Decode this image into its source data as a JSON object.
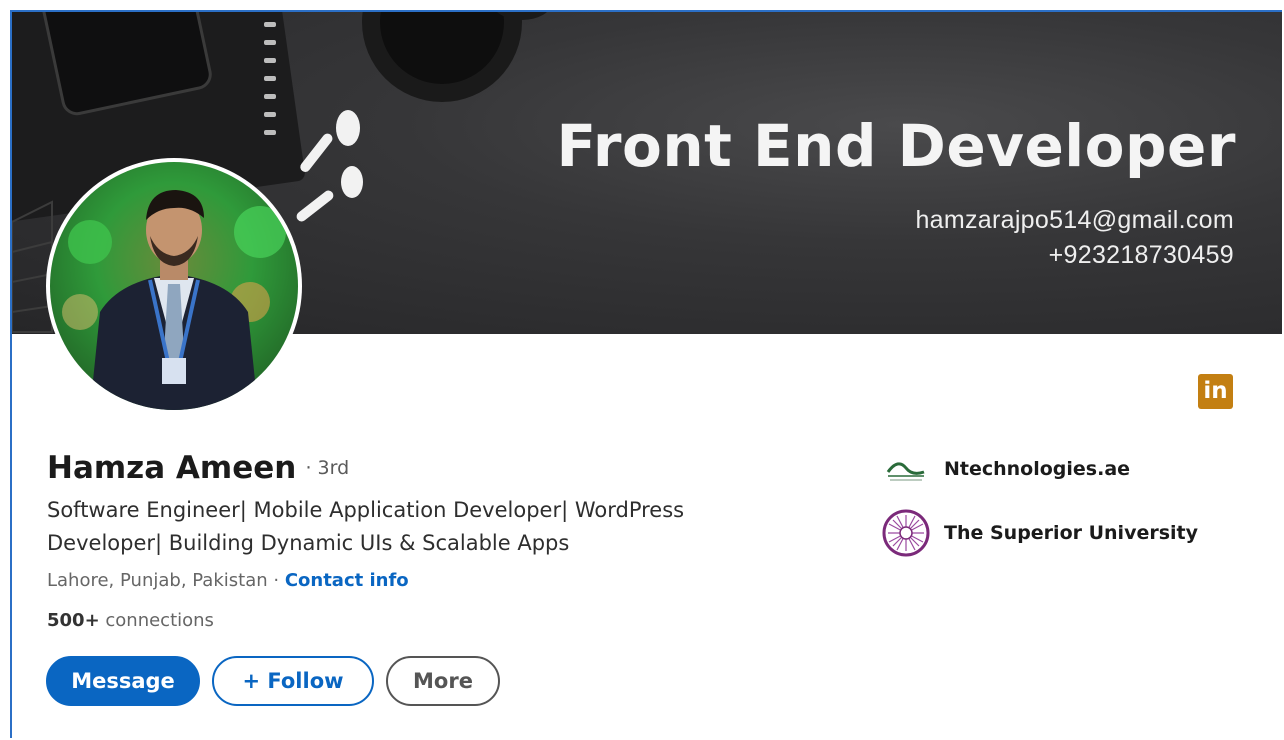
{
  "banner": {
    "title": "Front End Developer",
    "email": "hamzarajpo514@gmail.com",
    "phone": "+923218730459"
  },
  "profile": {
    "name": "Hamza Ameen",
    "degree": "· 3rd",
    "headline": "Software Engineer| Mobile Application Developer| WordPress Developer| Building Dynamic UIs & Scalable Apps",
    "location": "Lahore, Punjab, Pakistan",
    "separator": " · ",
    "contact_label": "Contact info",
    "connections_count": "500+",
    "connections_label": " connections"
  },
  "linkedin_badge": "in",
  "actions": {
    "message": "Message",
    "follow": "+ Follow",
    "more": "More"
  },
  "organizations": [
    {
      "name": "Ntechnologies.ae",
      "icon": "ntechnologies-logo"
    },
    {
      "name": "The Superior University",
      "icon": "superior-university-logo"
    }
  ],
  "colors": {
    "primary_blue": "#0a66c2",
    "linkedin_badge": "#c37f12",
    "banner_bg": "#2e2e30"
  }
}
